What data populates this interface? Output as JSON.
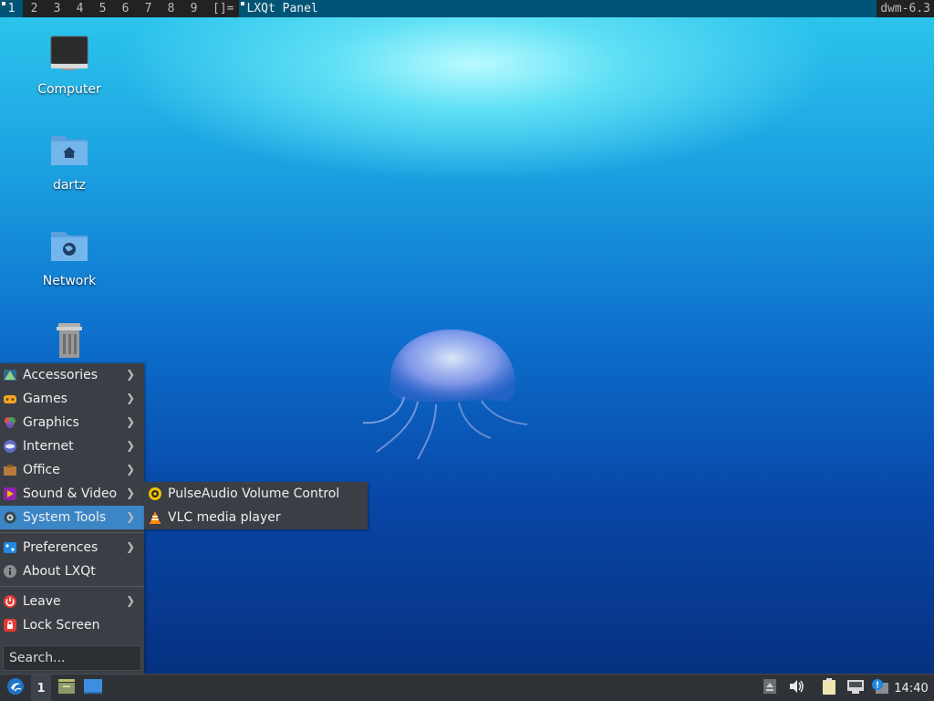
{
  "dwm": {
    "tags": [
      "1",
      "2",
      "3",
      "4",
      "5",
      "6",
      "7",
      "8",
      "9"
    ],
    "layout_symbol": "[]=",
    "window_title": "LXQt Panel",
    "status": "dwm-6.3"
  },
  "desktop": {
    "icons": [
      {
        "label": "Computer",
        "icon": "computer-icon"
      },
      {
        "label": "dartz",
        "icon": "home-folder-icon"
      },
      {
        "label": "Network",
        "icon": "network-folder-icon"
      },
      {
        "label": "",
        "icon": "trash-icon"
      }
    ]
  },
  "menu": {
    "items": [
      {
        "label": "Accessories",
        "icon": "accessories-icon"
      },
      {
        "label": "Games",
        "icon": "games-icon"
      },
      {
        "label": "Graphics",
        "icon": "graphics-icon"
      },
      {
        "label": "Internet",
        "icon": "internet-icon"
      },
      {
        "label": "Office",
        "icon": "office-icon"
      },
      {
        "label": "Sound & Video",
        "icon": "sound-video-icon"
      },
      {
        "label": "System Tools",
        "icon": "system-tools-icon"
      },
      {
        "label": "Preferences",
        "icon": "preferences-icon"
      },
      {
        "label": "About LXQt",
        "icon": "info-icon"
      },
      {
        "label": "Leave",
        "icon": "power-icon"
      },
      {
        "label": "Lock Screen",
        "icon": "lock-icon"
      }
    ],
    "search_placeholder": "Search...",
    "submenu": [
      {
        "label": "PulseAudio Volume Control",
        "icon": "pulseaudio-icon"
      },
      {
        "label": "VLC media player",
        "icon": "vlc-icon"
      }
    ]
  },
  "panel": {
    "desktop_switch": "1",
    "clock": "14:40"
  },
  "colors": {
    "highlight": "#3d86c6",
    "menu_bg": "#3b3f45",
    "dwm_accent": "#005577"
  }
}
